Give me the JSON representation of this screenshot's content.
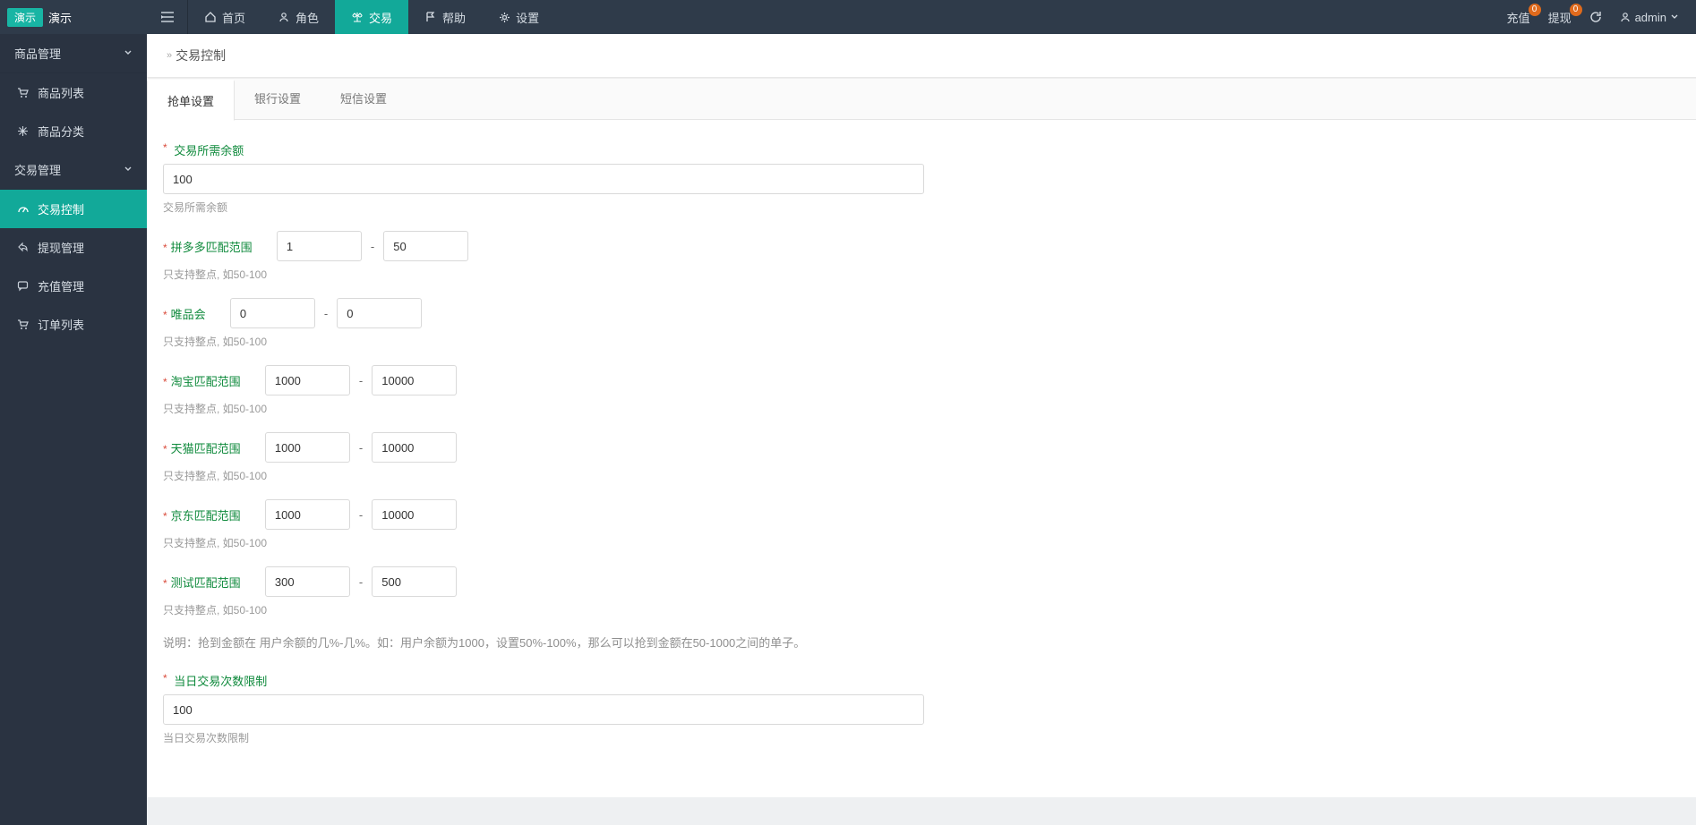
{
  "header": {
    "logo_left": "演示",
    "logo_right": "演示",
    "nav": [
      {
        "label": "首页",
        "icon": "home"
      },
      {
        "label": "角色",
        "icon": "user"
      },
      {
        "label": "交易",
        "icon": "scale",
        "active": true
      },
      {
        "label": "帮助",
        "icon": "flag"
      },
      {
        "label": "设置",
        "icon": "gear"
      }
    ],
    "right": {
      "recharge": "充值",
      "recharge_badge": "0",
      "withdraw": "提现",
      "withdraw_badge": "0",
      "user": "admin"
    }
  },
  "sidebar": {
    "groups": [
      {
        "title": "商品管理",
        "open": true,
        "items": [
          {
            "label": "商品列表",
            "icon": "cart"
          },
          {
            "label": "商品分类",
            "icon": "snow"
          }
        ]
      },
      {
        "title": "交易管理",
        "open": true,
        "items": [
          {
            "label": "交易控制",
            "icon": "dash",
            "active": true
          },
          {
            "label": "提现管理",
            "icon": "share"
          },
          {
            "label": "充值管理",
            "icon": "chat"
          },
          {
            "label": "订单列表",
            "icon": "ordercart"
          }
        ]
      }
    ]
  },
  "breadcrumb": {
    "title": "交易控制"
  },
  "tabs": [
    {
      "label": "抢单设置",
      "active": true
    },
    {
      "label": "银行设置"
    },
    {
      "label": "短信设置"
    }
  ],
  "form": {
    "balance": {
      "label": "交易所需余额",
      "value": "100",
      "help": "交易所需余额"
    },
    "ranges": [
      {
        "label": "拼多多匹配范围",
        "min": "1",
        "max": "50",
        "help": "只支持整点, 如50-100"
      },
      {
        "label": "唯品会",
        "min": "0",
        "max": "0",
        "help": "只支持整点, 如50-100"
      },
      {
        "label": "淘宝匹配范围",
        "min": "1000",
        "max": "10000",
        "help": "只支持整点, 如50-100"
      },
      {
        "label": "天猫匹配范围",
        "min": "1000",
        "max": "10000",
        "help": "只支持整点, 如50-100"
      },
      {
        "label": "京东匹配范围",
        "min": "1000",
        "max": "10000",
        "help": "只支持整点, 如50-100"
      },
      {
        "label": "测试匹配范围",
        "min": "300",
        "max": "500",
        "help": "只支持整点, 如50-100"
      }
    ],
    "explain": "说明：抢到金额在 用户余额的几%-几%。如：用户余额为1000，设置50%-100%，那么可以抢到金额在50-1000之间的单子。",
    "daily_limit": {
      "label": "当日交易次数限制",
      "value": "100",
      "help": "当日交易次数限制"
    }
  }
}
